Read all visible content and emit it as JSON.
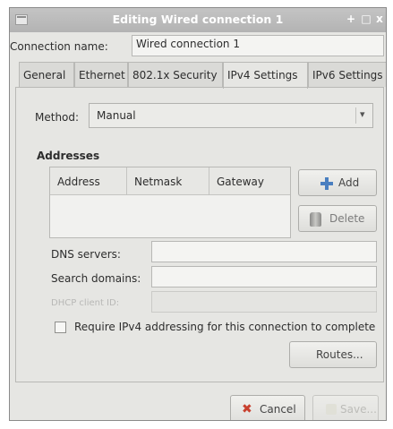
{
  "window": {
    "title": "Editing Wired connection 1",
    "controls": [
      "+",
      "□",
      "x"
    ]
  },
  "connection": {
    "name_label": "Connection name:",
    "name_value": "Wired connection 1"
  },
  "tabs": [
    {
      "label": "General"
    },
    {
      "label": "Ethernet"
    },
    {
      "label": "802.1x Security"
    },
    {
      "label": "IPv4 Settings",
      "active": true
    },
    {
      "label": "IPv6 Settings"
    }
  ],
  "method": {
    "label": "Method:",
    "value": "Manual"
  },
  "addresses": {
    "title": "Addresses",
    "columns": [
      "Address",
      "Netmask",
      "Gateway"
    ],
    "rows": [],
    "add_label": "Add",
    "delete_label": "Delete"
  },
  "fields": {
    "dns_label": "DNS servers:",
    "dns_value": "",
    "search_label": "Search domains:",
    "search_value": "",
    "dhcp_label": "DHCP client ID:",
    "dhcp_value": ""
  },
  "require": {
    "label": "Require IPv4 addressing for this connection to complete",
    "checked": false
  },
  "routes_label": "Routes...",
  "footer": {
    "cancel_label": "Cancel",
    "save_label": "Save..."
  },
  "icons": {
    "add": "plus-icon",
    "delete": "trash-can-icon",
    "cancel": "x-icon",
    "save": "save-icon",
    "method_dropdown": "chevron-down-icon"
  }
}
